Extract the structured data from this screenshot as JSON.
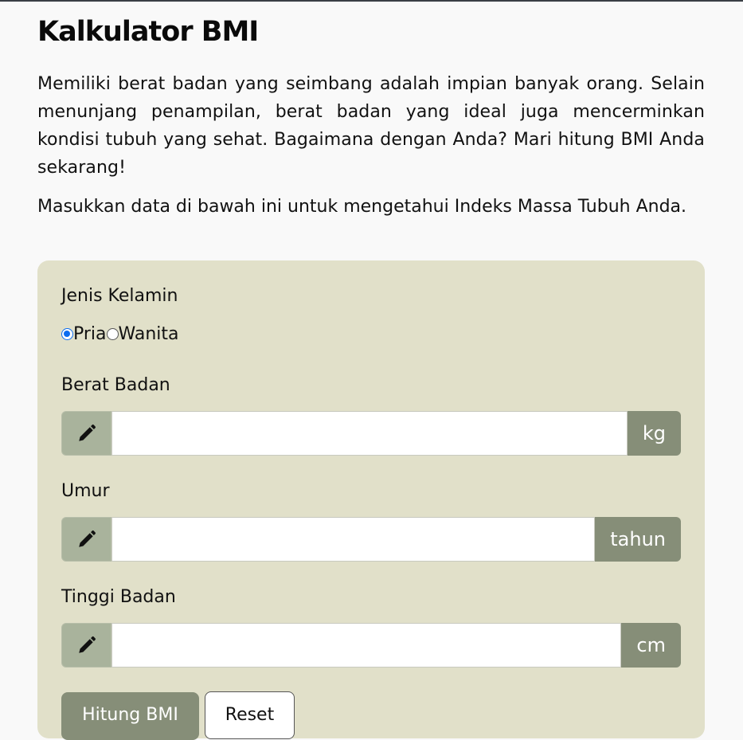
{
  "page": {
    "title": "Kalkulator BMI",
    "intro": "Memiliki berat badan yang seimbang adalah impian banyak orang. Selain menunjang penampilan, berat badan yang ideal juga mencerminkan kondisi tubuh yang sehat. Bagaimana dengan Anda? Mari hitung BMI Anda sekarang!",
    "lead": "Masukkan data di bawah ini untuk mengetahui Indeks Massa Tubuh Anda."
  },
  "form": {
    "gender": {
      "label": "Jenis Kelamin",
      "options": [
        {
          "label": "Pria",
          "selected": true
        },
        {
          "label": "Wanita",
          "selected": false
        }
      ]
    },
    "weight": {
      "label": "Berat Badan",
      "value": "",
      "unit": "kg"
    },
    "age": {
      "label": "Umur",
      "value": "",
      "unit": "tahun"
    },
    "height": {
      "label": "Tinggi Badan",
      "value": "",
      "unit": "cm"
    },
    "submit_label": "Hitung BMI",
    "reset_label": "Reset"
  },
  "icons": {
    "input_prefix": "pencil-icon"
  },
  "colors": {
    "card_bg": "#e1e0c9",
    "prefix_bg": "#a9b39c",
    "suffix_bg": "#868e78",
    "radio_accent": "#0b6cf0"
  }
}
